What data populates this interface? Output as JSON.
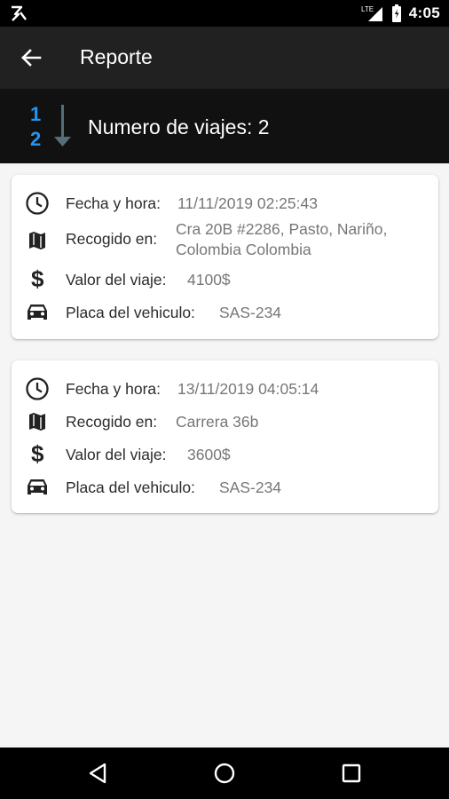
{
  "status_bar": {
    "time": "4:05",
    "network_label": "LTE",
    "icons": [
      "notification-icon",
      "signal-icon",
      "battery-icon"
    ]
  },
  "app_bar": {
    "title": "Reporte",
    "back_icon": "arrow-back-icon"
  },
  "summary": {
    "icon": "sort-numeric-icon",
    "sort_digits": [
      "1",
      "2"
    ],
    "text": "Numero de viajes: 2"
  },
  "trips": [
    {
      "datetime_label": "Fecha y hora:",
      "datetime_value": "11/11/2019 02:25:43",
      "pickup_label": "Recogido en:",
      "pickup_value": "Cra 20B #2286, Pasto, Nariño,\nColombia  Colombia",
      "price_label": "Valor del viaje:",
      "price_value": "4100$",
      "plate_label": "Placa del vehiculo:",
      "plate_value": "SAS-234"
    },
    {
      "datetime_label": "Fecha y hora:",
      "datetime_value": "13/11/2019 04:05:14",
      "pickup_label": "Recogido en:",
      "pickup_value": "Carrera 36b",
      "price_label": "Valor del viaje:",
      "price_value": "3600$",
      "plate_label": "Placa del vehiculo:",
      "plate_value": "SAS-234"
    }
  ],
  "nav_bar": {
    "icons": [
      "back-triangle-icon",
      "home-circle-icon",
      "recents-square-icon"
    ]
  },
  "colors": {
    "app_bar": "#212121",
    "summary_bar": "#111111",
    "sort_digits": "#2196f3",
    "sort_arrow": "#546e7a",
    "background": "#f5f5f5",
    "label_text": "#2b2b2b",
    "value_text": "#777777"
  }
}
